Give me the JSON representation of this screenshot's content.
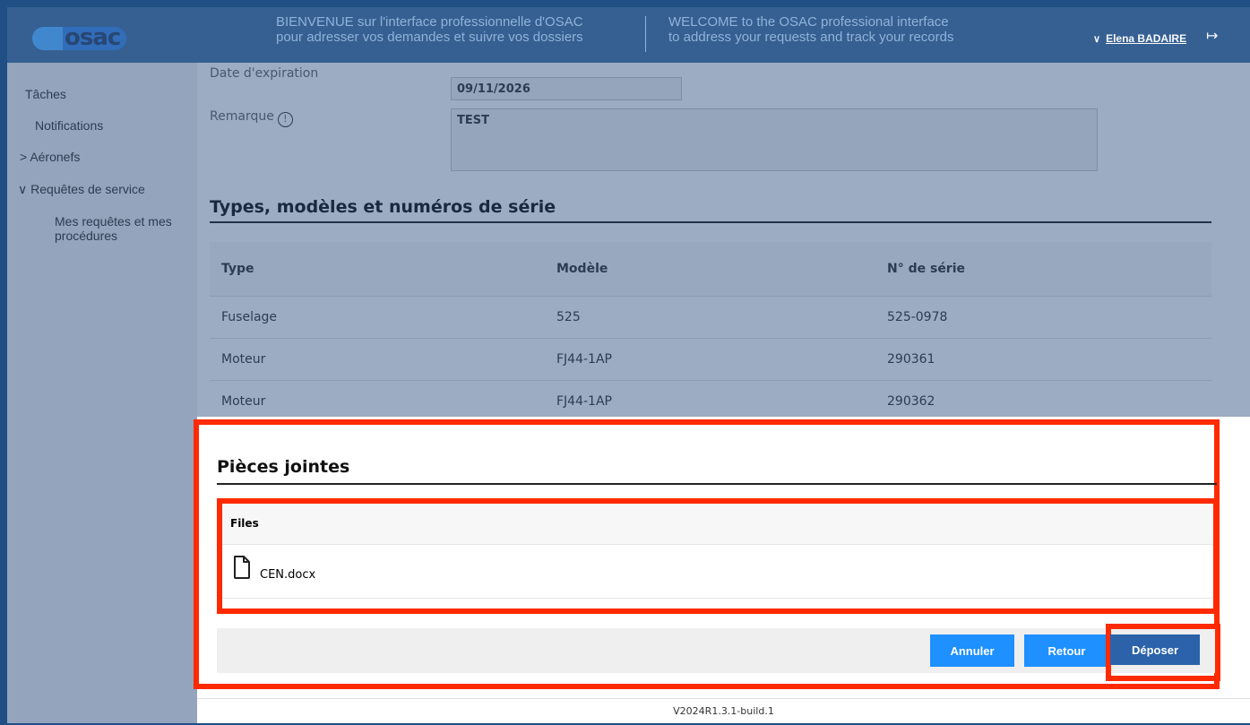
{
  "header": {
    "logo_text": "osac",
    "welcome_fr_line1": "BIENVENUE sur l'interface professionnelle d'OSAC",
    "welcome_fr_line2": "pour adresser vos demandes et suivre vos dossiers",
    "welcome_en_line1": "WELCOME to the OSAC professional interface",
    "welcome_en_line2": "to address your requests and track your records",
    "user_name": "Elena BADAIRE"
  },
  "sidebar": {
    "items": [
      {
        "label": "Tâches"
      },
      {
        "label": "Notifications"
      },
      {
        "label": "Aéronefs"
      },
      {
        "label": "Requêtes de service"
      },
      {
        "label": "Mes requêtes et mes"
      },
      {
        "label": "procédures"
      }
    ]
  },
  "form": {
    "expiration_label": "Date d'expiration",
    "expiration_value": "09/11/2026",
    "remark_label": "Remarque",
    "remark_value": "TEST"
  },
  "types_section": {
    "title": "Types, modèles et numéros de série",
    "columns": [
      "Type",
      "Modèle",
      "N° de série"
    ],
    "rows": [
      [
        "Fuselage",
        "525",
        "525-0978"
      ],
      [
        "Moteur",
        "FJ44-1AP",
        "290361"
      ],
      [
        "Moteur",
        "FJ44-1AP",
        "290362"
      ]
    ]
  },
  "attachments": {
    "title": "Pièces jointes",
    "files_header": "Files",
    "files": [
      {
        "name": "CEN.docx"
      }
    ]
  },
  "actions": {
    "cancel": "Annuler",
    "back": "Retour",
    "submit": "Déposer"
  },
  "footer": {
    "version": "V2024R1.3.1-build.1"
  },
  "colors": {
    "header_bg": "#2e5a8f",
    "primary_button": "#1e90ff",
    "submit_button": "#2b62a9",
    "highlight": "#ff2a00"
  }
}
